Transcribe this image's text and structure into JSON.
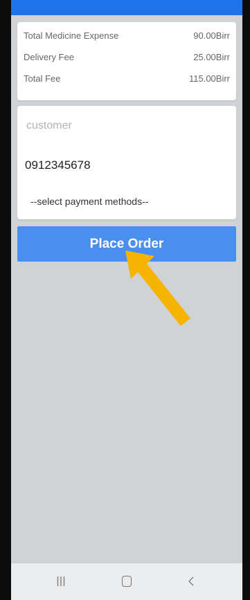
{
  "status_bar": {
    "left_text": "",
    "right_text": ""
  },
  "order_summary": {
    "rows": [
      {
        "label": "Total Medicine Expense",
        "value": "90.00Birr"
      },
      {
        "label": "Delivery Fee",
        "value": "25.00Birr"
      },
      {
        "label": "Total Fee",
        "value": "115.00Birr"
      }
    ]
  },
  "form": {
    "customer_placeholder": "customer",
    "phone_value": "0912345678",
    "payment_placeholder": "--select payment methods--"
  },
  "place_order_label": "Place Order",
  "colors": {
    "status_bar": "#1e73e8",
    "button": "#4a8ff0",
    "annotation_arrow": "#f5b400",
    "screen_background": "#d0d3d6"
  },
  "icons": {
    "annotation": "arrow-pointer-icon",
    "nav_recent": "recent-apps-icon",
    "nav_home": "home-icon",
    "nav_back": "back-icon"
  }
}
